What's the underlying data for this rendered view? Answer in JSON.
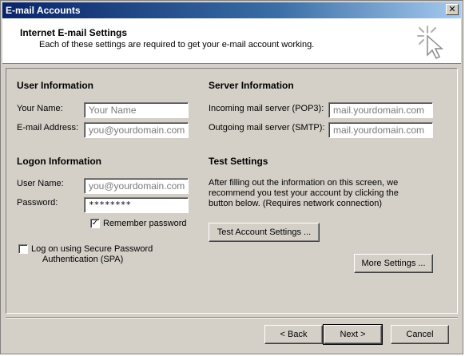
{
  "window": {
    "title": "E-mail Accounts",
    "close_glyph": "✕"
  },
  "header": {
    "title": "Internet E-mail Settings",
    "subtitle": "Each of these settings are required to get your e-mail account working.",
    "icon": "wizard-sparkle-cursor-icon"
  },
  "user_info": {
    "heading": "User Information",
    "name_label": "Your Name:",
    "name_value": "Your Name",
    "email_label": "E-mail Address:",
    "email_value": "you@yourdomain.com"
  },
  "logon_info": {
    "heading": "Logon Information",
    "user_label": "User Name:",
    "user_value": "you@yourdomain.com",
    "password_label": "Password:",
    "password_value": "********",
    "remember_label": "Remember password",
    "remember_checked": "✓",
    "spa_label_line1": "Log on using Secure Password",
    "spa_label_line2": "Authentication (SPA)"
  },
  "server_info": {
    "heading": "Server Information",
    "incoming_label": "Incoming mail server (POP3):",
    "incoming_value": "mail.yourdomain.com",
    "outgoing_label": "Outgoing mail server (SMTP):",
    "outgoing_value": "mail.yourdomain.com"
  },
  "test_settings": {
    "heading": "Test Settings",
    "line1": "After filling out the information on this screen, we",
    "line2": "recommend you test your account by clicking the",
    "line3": "button below. (Requires network connection)",
    "test_button": "Test Account Settings ...",
    "more_button": "More Settings ..."
  },
  "footer": {
    "back_button": "< Back",
    "next_button": "Next >",
    "cancel_button": "Cancel"
  },
  "colors": {
    "face": "#d4d0c8",
    "title_start": "#0a246a",
    "title_end": "#a6caf0"
  }
}
